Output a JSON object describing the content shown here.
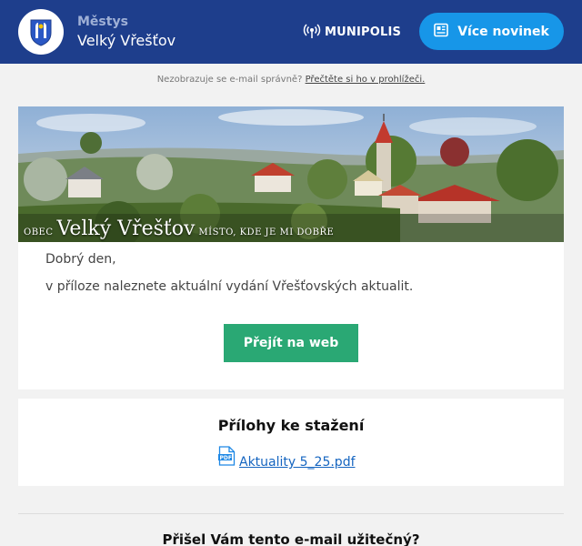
{
  "header": {
    "municipality_type": "Městys",
    "municipality_name": "Velký Vřešťov",
    "logo_icon": "municipal-crest-icon",
    "partner_label": "MUNIPOLIS",
    "partner_icon": "broadcast-icon",
    "news_button_label": "Více novinek",
    "news_button_icon": "newspaper-icon"
  },
  "browser_note": {
    "text": "Nezobrazuje se e-mail správně?",
    "link": "Přečtěte si ho v prohlížeči."
  },
  "banner": {
    "caption_prefix": "OBEC",
    "caption_name": "Velký Vřešťov",
    "caption_motto": "MÍSTO, KDE JE MI DOBŘE"
  },
  "message": {
    "greeting": "Dobrý den,",
    "body": "v příloze naleznete aktuální vydání Vřešťovských aktualit.",
    "cta_label": "Přejít na web"
  },
  "attachments": {
    "title": "Přílohy ke stažení",
    "items": [
      {
        "icon": "pdf-file-icon",
        "name": "Aktuality 5_25.pdf"
      }
    ]
  },
  "feedback": {
    "question": "Přišel Vám tento e-mail užitečný?"
  },
  "colors": {
    "header_bg": "#1e3e8c",
    "news_button": "#1796e8",
    "cta_button": "#2aa874",
    "link": "#1565c0"
  }
}
